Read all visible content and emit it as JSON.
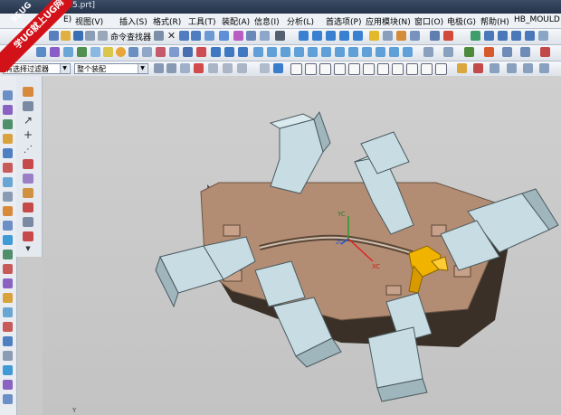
{
  "window": {
    "title": "5.prt]"
  },
  "watermark": {
    "brand": "9SUG",
    "slogan": "学UG就上UG网"
  },
  "menu": {
    "items": [
      {
        "label": "视图(V)"
      },
      {
        "label": "插入(S)"
      },
      {
        "label": "格式(R)"
      },
      {
        "label": "工具(T)"
      },
      {
        "label": "装配(A)"
      },
      {
        "label": "信息(I)"
      },
      {
        "label": "分析(L)"
      },
      {
        "label": "首选项(P)"
      },
      {
        "label": "应用模块(N)"
      },
      {
        "label": "窗口(O)"
      },
      {
        "label": "电极(G)"
      },
      {
        "label": "帮助(H)"
      },
      {
        "label": "HB_MOULD M6.8"
      }
    ],
    "partial_first": "E)"
  },
  "toolbar": {
    "command_finder_label": "命令查找器",
    "selection_filter": {
      "value": "有选择过滤器"
    },
    "assembly_scope": {
      "value": "整个装配"
    }
  },
  "viewport": {
    "axes": {
      "x_label": "XC",
      "y_label": "YC",
      "z_label": "ZC"
    },
    "colors": {
      "plate": "#b38d73",
      "plate_edge": "#3a3027",
      "slide": "#c8dde3",
      "slide_edge": "#4a5a60",
      "insert": "#f0b400",
      "background": "#c8c8c8"
    }
  },
  "status": {
    "bottom_marker": "Y"
  }
}
